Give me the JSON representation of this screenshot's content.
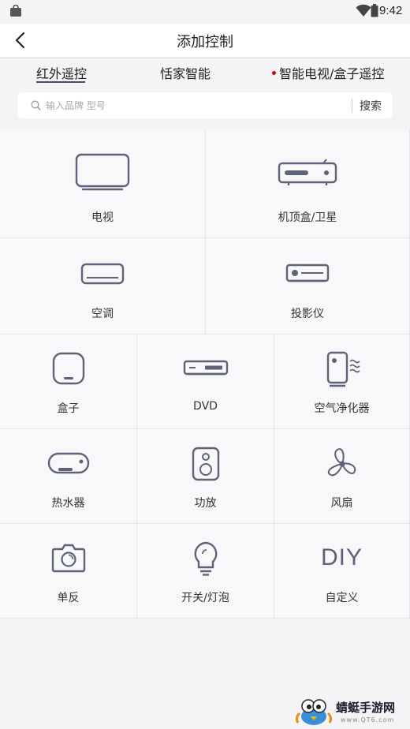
{
  "status_bar": {
    "time": "9:42"
  },
  "header": {
    "title": "添加控制"
  },
  "tabs": [
    {
      "label": "红外遥控",
      "active": true
    },
    {
      "label": "恬家智能",
      "active": false
    },
    {
      "label": "智能电视/盒子遥控",
      "active": false,
      "badge_color": "#d0021b"
    }
  ],
  "search": {
    "placeholder": "输入品牌 型号",
    "button_label": "搜索"
  },
  "devices": [
    {
      "label": "电视",
      "icon": "tv-icon"
    },
    {
      "label": "机顶盒/卫星",
      "icon": "set-top-box-icon"
    },
    {
      "label": "空调",
      "icon": "air-conditioner-icon"
    },
    {
      "label": "投影仪",
      "icon": "projector-icon"
    },
    {
      "label": "盒子",
      "icon": "box-icon"
    },
    {
      "label": "DVD",
      "icon": "dvd-icon"
    },
    {
      "label": "空气净化器",
      "icon": "air-purifier-icon"
    },
    {
      "label": "热水器",
      "icon": "water-heater-icon"
    },
    {
      "label": "功放",
      "icon": "amplifier-icon"
    },
    {
      "label": "风扇",
      "icon": "fan-icon"
    },
    {
      "label": "单反",
      "icon": "camera-icon"
    },
    {
      "label": "开关/灯泡",
      "icon": "light-bulb-icon"
    },
    {
      "label": "自定义",
      "icon": "diy-icon",
      "icon_text": "DIY"
    }
  ],
  "watermark": {
    "text": "蜻蜓手游网",
    "url": "www.QT6.com"
  },
  "colors": {
    "icon_stroke": "#5d6378",
    "accent_dot": "#d0021b"
  }
}
